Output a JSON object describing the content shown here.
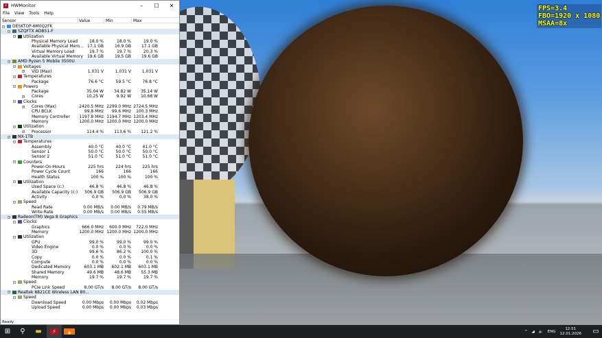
{
  "window": {
    "title": "HWMonitor",
    "menu": [
      "File",
      "View",
      "Tools",
      "Help"
    ],
    "columns": [
      "Sensor",
      "Value",
      "Min",
      "Max"
    ],
    "status": "Ready"
  },
  "hud": {
    "fps": "FPS=3.4",
    "fbo": "FBO=1920 x 1080",
    "msaa": "MSAA=8x"
  },
  "rows": [
    {
      "lvl": 0,
      "t": "root",
      "icon": "computer-icon",
      "label": "DESKTOP-6M0Q2FK"
    },
    {
      "lvl": 1,
      "t": "dev",
      "icon": "motherboard-icon",
      "label": "SZQFTX ADB51-F"
    },
    {
      "lvl": 2,
      "t": "grp",
      "icon": "utilization-icon",
      "label": "Utilization"
    },
    {
      "lvl": 3,
      "label": "Physical Memory Load",
      "v": "18.0 %",
      "min": "18.0 %",
      "max": "19.0 %"
    },
    {
      "lvl": 3,
      "label": "Available Physical Mem...",
      "v": "17.1 GB",
      "min": "16.9 GB",
      "max": "17.1 GB"
    },
    {
      "lvl": 3,
      "label": "Virtual Memory Load",
      "v": "19.7 %",
      "min": "19.7 %",
      "max": "20.3 %"
    },
    {
      "lvl": 3,
      "label": "Available Virtual Memory",
      "v": "19.6 GB",
      "min": "19.5 GB",
      "max": "19.6 GB"
    },
    {
      "lvl": 1,
      "t": "dev",
      "icon": "cpu-icon",
      "label": "AMD Ryzen 5 Mobile 3500U"
    },
    {
      "lvl": 2,
      "t": "grp",
      "icon": "voltage-icon",
      "label": "Voltages"
    },
    {
      "lvl": 3,
      "exp": true,
      "label": "VID (Max)",
      "v": "1.031 V",
      "min": "1.031 V",
      "max": "1.031 V"
    },
    {
      "lvl": 2,
      "t": "grp",
      "icon": "thermometer-icon",
      "label": "Temperatures"
    },
    {
      "lvl": 3,
      "label": "Package",
      "v": "76.6 °C",
      "min": "59.5 °C",
      "max": "76.8 °C"
    },
    {
      "lvl": 2,
      "t": "grp",
      "icon": "power-icon",
      "label": "Powers"
    },
    {
      "lvl": 3,
      "label": "Package",
      "v": "35.04 W",
      "min": "34.82 W",
      "max": "35.14 W"
    },
    {
      "lvl": 3,
      "exp": true,
      "label": "Cores",
      "v": "10.25 W",
      "min": "9.92 W",
      "max": "10.68 W"
    },
    {
      "lvl": 2,
      "t": "grp",
      "icon": "clock-icon",
      "label": "Clocks"
    },
    {
      "lvl": 3,
      "exp": true,
      "label": "Cores (Max)",
      "v": "2420.5 MHz",
      "min": "2299.0 MHz",
      "max": "2724.5 MHz"
    },
    {
      "lvl": 3,
      "label": "CPU BCLK",
      "v": "99.8 MHz",
      "min": "99.6 MHz",
      "max": "100.3 MHz"
    },
    {
      "lvl": 3,
      "label": "Memory Controller",
      "v": "1197.8 MHz",
      "min": "1194.7 MHz",
      "max": "1203.4 MHz"
    },
    {
      "lvl": 3,
      "label": "Memory",
      "v": "1200.0 MHz",
      "min": "1200.0 MHz",
      "max": "1200.0 MHz"
    },
    {
      "lvl": 2,
      "t": "grp",
      "icon": "utilization-icon",
      "label": "Utilization"
    },
    {
      "lvl": 3,
      "exp": true,
      "label": "Processor",
      "v": "114.4 %",
      "min": "113.6 %",
      "max": "121.2 %"
    },
    {
      "lvl": 1,
      "t": "dev",
      "icon": "drive-icon",
      "label": "NX-1TB"
    },
    {
      "lvl": 2,
      "t": "grp",
      "icon": "thermometer-icon",
      "label": "Temperatures"
    },
    {
      "lvl": 3,
      "label": "Assembly",
      "v": "40.0 °C",
      "min": "40.0 °C",
      "max": "41.0 °C"
    },
    {
      "lvl": 3,
      "label": "Sensor 1",
      "v": "50.0 °C",
      "min": "50.0 °C",
      "max": "50.0 °C"
    },
    {
      "lvl": 3,
      "label": "Sensor 2",
      "v": "51.0 °C",
      "min": "51.0 °C",
      "max": "51.0 °C"
    },
    {
      "lvl": 2,
      "t": "grp",
      "icon": "counter-icon",
      "label": "Counters"
    },
    {
      "lvl": 3,
      "label": "Power-On-Hours",
      "v": "225 hrs",
      "min": "224 hrs",
      "max": "225 hrs"
    },
    {
      "lvl": 3,
      "label": "Power Cycle Count",
      "v": "166",
      "min": "166",
      "max": "166"
    },
    {
      "lvl": 3,
      "label": "Health Status",
      "v": "100 %",
      "min": "100 %",
      "max": "100 %"
    },
    {
      "lvl": 2,
      "t": "grp",
      "icon": "utilization-icon",
      "label": "Utilization"
    },
    {
      "lvl": 3,
      "label": "Used Space (c:)",
      "v": "46.8 %",
      "min": "46.8 %",
      "max": "46.8 %"
    },
    {
      "lvl": 3,
      "label": "Available Capacity (c:)",
      "v": "506.9 GB",
      "min": "506.9 GB",
      "max": "506.9 GB"
    },
    {
      "lvl": 3,
      "label": "Activity",
      "v": "0.0 %",
      "min": "0.0 %",
      "max": "38.0 %"
    },
    {
      "lvl": 2,
      "t": "grp",
      "icon": "speed-icon",
      "label": "Speed"
    },
    {
      "lvl": 3,
      "label": "Read Rate",
      "v": "0.00 MB/s",
      "min": "0.00 MB/s",
      "max": "0.79 MB/s"
    },
    {
      "lvl": 3,
      "label": "Write Rate",
      "v": "0.00 MB/s",
      "min": "0.00 MB/s",
      "max": "0.55 MB/s"
    },
    {
      "lvl": 1,
      "t": "dev",
      "icon": "gpu-icon",
      "label": "Radeon(TM) Vega 8 Graphics"
    },
    {
      "lvl": 2,
      "t": "grp",
      "icon": "clock-icon",
      "label": "Clocks"
    },
    {
      "lvl": 3,
      "label": "Graphics",
      "v": "666.0 MHz",
      "min": "600.0 MHz",
      "max": "722.0 MHz"
    },
    {
      "lvl": 3,
      "label": "Memory",
      "v": "1200.0 MHz",
      "min": "1200.0 MHz",
      "max": "1200.0 MHz"
    },
    {
      "lvl": 2,
      "t": "grp",
      "icon": "utilization-icon",
      "label": "Utilization"
    },
    {
      "lvl": 3,
      "label": "GPU",
      "v": "99.0 %",
      "min": "99.0 %",
      "max": "99.0 %"
    },
    {
      "lvl": 3,
      "label": "Video Engine",
      "v": "0.0 %",
      "min": "0.0 %",
      "max": "0.0 %"
    },
    {
      "lvl": 3,
      "label": "3D",
      "v": "99.6 %",
      "min": "86.2 %",
      "max": "100.0 %"
    },
    {
      "lvl": 3,
      "label": "Copy",
      "v": "0.0 %",
      "min": "0.0 %",
      "max": "0.1 %"
    },
    {
      "lvl": 3,
      "label": "Compute",
      "v": "0.0 %",
      "min": "0.0 %",
      "max": "0.0 %"
    },
    {
      "lvl": 3,
      "label": "Dedicated Memory",
      "v": "603.1 MB",
      "min": "602.1 MB",
      "max": "603.1 MB"
    },
    {
      "lvl": 3,
      "label": "Shared Memory",
      "v": "49.6 MB",
      "min": "48.6 MB",
      "max": "55.3 MB"
    },
    {
      "lvl": 3,
      "label": "Memory",
      "v": "19.7 %",
      "min": "19.7 %",
      "max": "19.7 %"
    },
    {
      "lvl": 2,
      "t": "grp",
      "icon": "speed-icon",
      "label": "Speed"
    },
    {
      "lvl": 3,
      "label": "PCIe Link Speed",
      "v": "8.00 GT/s",
      "min": "8.00 GT/s",
      "max": "8.00 GT/s"
    },
    {
      "lvl": 1,
      "t": "dev",
      "icon": "network-icon",
      "label": "Realtek 8821CE Wireless LAN 80..."
    },
    {
      "lvl": 2,
      "t": "grp",
      "icon": "speed-icon",
      "label": "Speed"
    },
    {
      "lvl": 3,
      "label": "Download Speed",
      "v": "0.00 Mbps",
      "min": "0.00 Mbps",
      "max": "0.02 Mbps"
    },
    {
      "lvl": 3,
      "label": "Upload Speed",
      "v": "0.00 Mbps",
      "min": "0.00 Mbps",
      "max": "0.03 Mbps"
    }
  ],
  "taskbar": {
    "lang": "ENG",
    "time": "12:51",
    "date": "12.01.2026"
  },
  "icon_colors": {
    "cpu-icon": "#7a8a2a",
    "motherboard-icon": "#4a6080",
    "drive-icon": "#333333",
    "gpu-icon": "#333333",
    "network-icon": "#2a6a3a",
    "computer-icon": "#3a8de0",
    "utilization-icon": "#1a3a1a",
    "voltage-icon": "#d4a020",
    "thermometer-icon": "#d02020",
    "power-icon": "#f09020",
    "clock-icon": "#5050a0",
    "counter-icon": "#30a030",
    "speed-icon": "#a0a060"
  }
}
